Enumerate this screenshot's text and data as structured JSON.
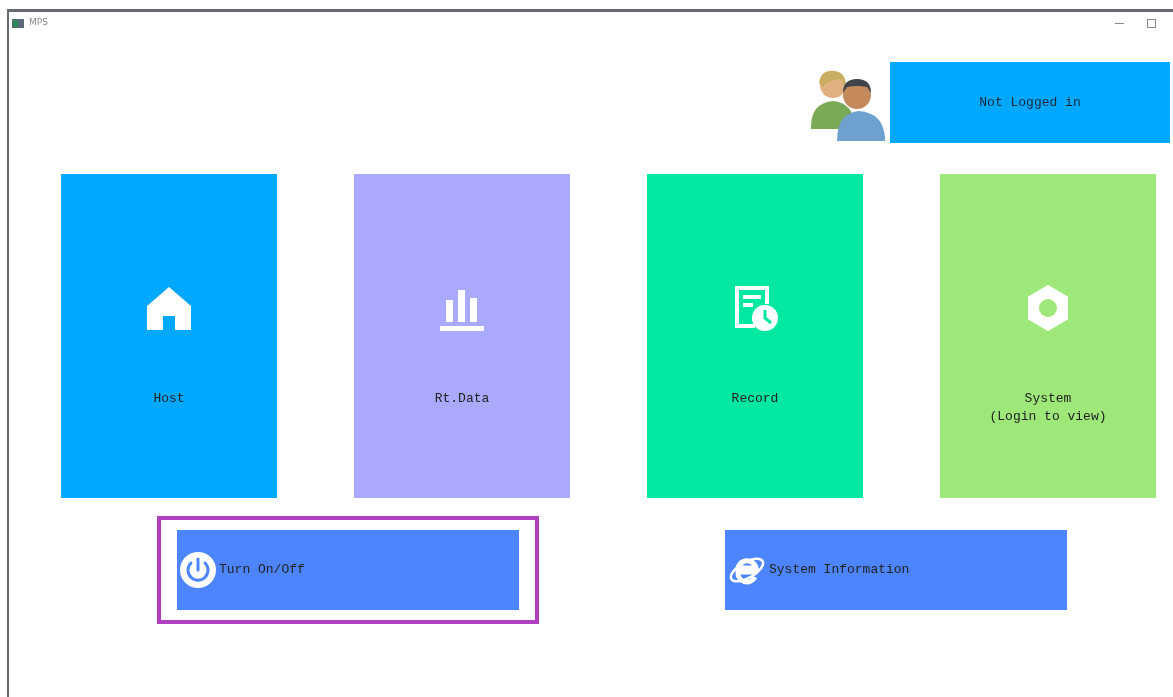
{
  "window": {
    "title": "MPS"
  },
  "user": {
    "status": "Not Logged in"
  },
  "tiles": [
    {
      "label": "Host",
      "color": "#00a8ff"
    },
    {
      "label": "Rt.Data",
      "color": "#a9aaff"
    },
    {
      "label": "Record",
      "color": "#00e8a2"
    },
    {
      "label": "System\n(Login to view)",
      "color": "#9de878"
    }
  ],
  "buttons": [
    {
      "label": "Turn On/Off",
      "focused": true
    },
    {
      "label": "System Information",
      "focused": false
    }
  ]
}
